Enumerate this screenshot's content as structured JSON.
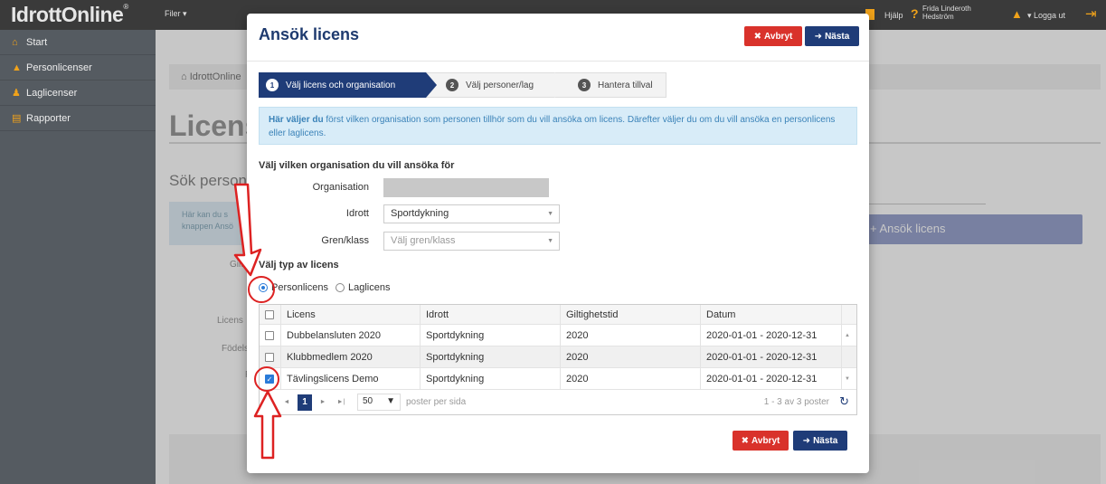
{
  "topbar": {
    "logo": "IdrottOnline",
    "logo_mark": "®",
    "files_label": "Filer ▾",
    "help_label": "Hjälp",
    "help_icon": "question-icon",
    "user_name_line1": "Frida Linderoth",
    "user_name_line2": "Hedström",
    "logout_label": "▾ Logga ut"
  },
  "sidebar": {
    "items": [
      {
        "label": "Start",
        "icon": "home-icon",
        "glyph": "⌂"
      },
      {
        "label": "Personlicenser",
        "icon": "user-icon",
        "glyph": "▲"
      },
      {
        "label": "Laglicenser",
        "icon": "users-icon",
        "glyph": "♟"
      },
      {
        "label": "Rapporter",
        "icon": "chart-icon",
        "glyph": "▤"
      }
    ]
  },
  "background": {
    "breadcrumb": "IdrottOnline",
    "title": "Licens",
    "search_heading": "Sök personl",
    "info_text_1": "Här kan du s",
    "info_text_2": "knappen Ansö",
    "label_giltig": "Gilti",
    "label_licens": "Licens",
    "label_fodels": "Födels",
    "label_f": "F",
    "apply_button": "+   Ansök licens"
  },
  "modal": {
    "title": "Ansök licens",
    "cancel_label": "Avbryt",
    "next_label": "Nästa",
    "steps": [
      {
        "num": "1",
        "label": "Välj licens och organisation"
      },
      {
        "num": "2",
        "label": "Välj personer/lag"
      },
      {
        "num": "3",
        "label": "Hantera tillval"
      }
    ],
    "info_bold": "Här väljer du",
    "info_rest": " först vilken organisation som personen tillhör som du vill ansöka om licens. Därefter väljer du om du vill ansöka en personlicens eller laglicens.",
    "org_section_heading": "Välj vilken organisation du vill ansöka för",
    "org_label": "Organisation",
    "sport_label": "Idrott",
    "sport_value": "Sportdykning",
    "class_label": "Gren/klass",
    "class_placeholder": "Välj gren/klass",
    "type_heading": "Välj typ av licens",
    "radio_person": "Personlicens",
    "radio_team": "Laglicens",
    "grid": {
      "headers": [
        "Licens",
        "Idrott",
        "Giltighetstid",
        "Datum"
      ],
      "rows": [
        {
          "licens": "Dubbelansluten 2020",
          "idrott": "Sportdykning",
          "giltighet": "2020",
          "datum": "2020-01-01 - 2020-12-31",
          "checked": false
        },
        {
          "licens": "Klubbmedlem 2020",
          "idrott": "Sportdykning",
          "giltighet": "2020",
          "datum": "2020-01-01 - 2020-12-31",
          "checked": false
        },
        {
          "licens": "Tävlingslicens Demo",
          "idrott": "Sportdykning",
          "giltighet": "2020",
          "datum": "2020-01-01 - 2020-12-31",
          "checked": true
        }
      ],
      "current_page": "1",
      "page_size": "50",
      "page_size_suffix": "poster per sida",
      "page_info": "1 - 3 av 3 poster"
    }
  },
  "colors": {
    "accent": "#1f3c78",
    "danger": "#d9322b",
    "annotation": "#d22222"
  }
}
